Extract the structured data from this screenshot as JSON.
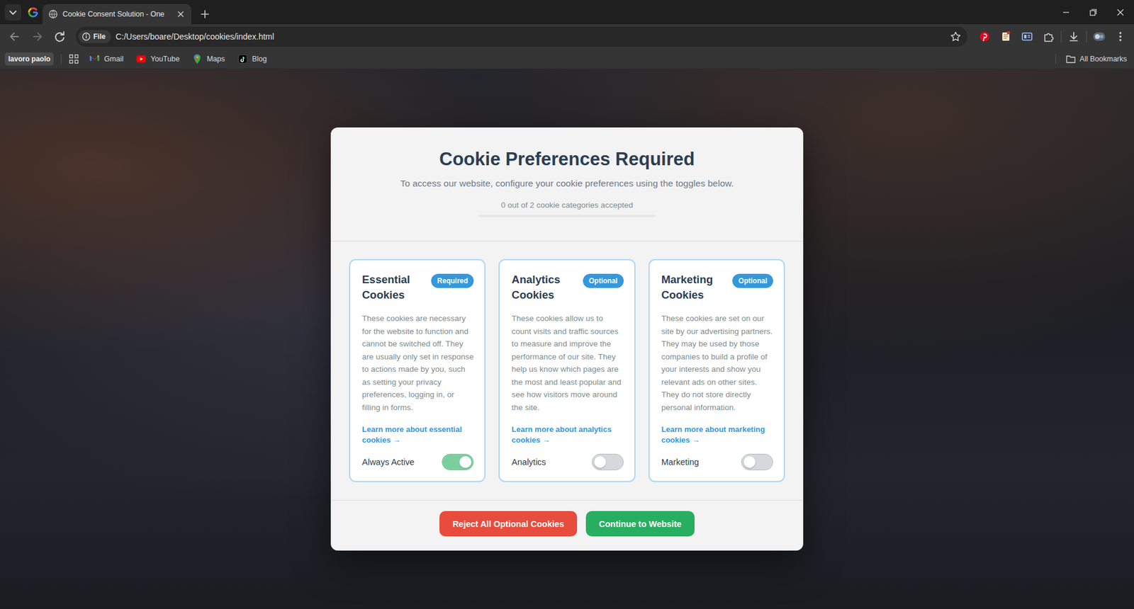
{
  "window": {
    "title": "Cookie Consent Solution - One"
  },
  "address_bar": {
    "chip": "File",
    "url": "C:/Users/boare/Desktop/cookies/index.html"
  },
  "bookmarks": {
    "profile_chip": "lavoro paolo",
    "items": [
      {
        "label": "Gmail"
      },
      {
        "label": "YouTube"
      },
      {
        "label": "Maps"
      },
      {
        "label": "Blog"
      }
    ],
    "all": "All Bookmarks"
  },
  "modal": {
    "title": "Cookie Preferences Required",
    "subtitle": "To access our website, configure your cookie preferences using the toggles below.",
    "progress": {
      "text": "0 out of 2 cookie categories accepted",
      "level": 0
    },
    "cards": [
      {
        "title": "Essential Cookies",
        "badge": "Required",
        "description": "These cookies are necessary for the website to function and cannot be switched off. They are usually only set in response to actions made by you, such as setting your privacy preferences, logging in, or filling in forms.",
        "link": "Learn more about essential cookies →",
        "toggle_label": "Always Active",
        "on": true,
        "disabled": true
      },
      {
        "title": "Analytics Cookies",
        "badge": "Optional",
        "description": "These cookies allow us to count visits and traffic sources to measure and improve the performance of our site. They help us know which pages are the most and least popular and see how visitors move around the site.",
        "link": "Learn more about analytics cookies →",
        "toggle_label": "Analytics",
        "on": false,
        "disabled": false
      },
      {
        "title": "Marketing Cookies",
        "badge": "Optional",
        "description": "These cookies are set on our site by our advertising partners. They may be used by those companies to build a profile of your interests and show you relevant ads on other sites. They do not store directly personal information.",
        "link": "Learn more about marketing cookies →",
        "toggle_label": "Marketing",
        "on": false,
        "disabled": false
      }
    ],
    "buttons": [
      {
        "label": "Reject All Optional Cookies",
        "color": "#e74c3c"
      },
      {
        "label": "Continue to Website",
        "color": "#27ae60"
      }
    ]
  }
}
